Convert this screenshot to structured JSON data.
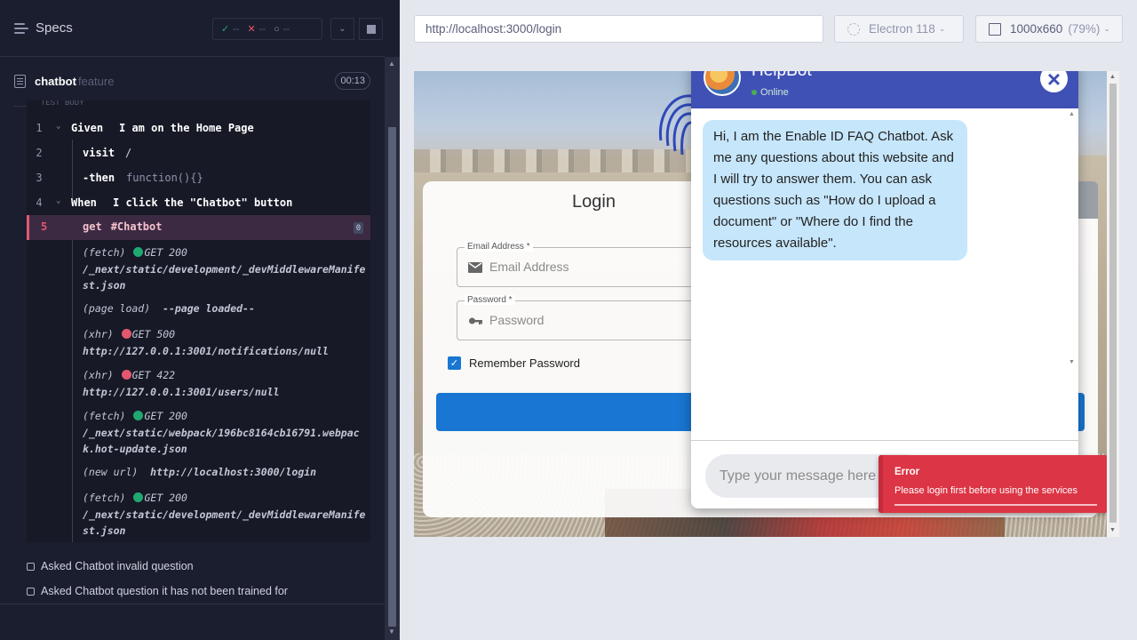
{
  "runner": {
    "header": {
      "title": "Specs"
    },
    "stats": {
      "passed": "--",
      "failed": "--",
      "pending": "--"
    },
    "spec": {
      "name": "chatbot",
      "ext": "feature",
      "duration": "00:13"
    },
    "section_cut_label": "TEST BODY",
    "lines": [
      {
        "num": "1",
        "keyword": "Given",
        "text": "I am on the Home Page"
      },
      {
        "num": "2",
        "cmd": "visit",
        "arg": "/"
      },
      {
        "num": "3",
        "cmd": "-then",
        "arg": "function(){}"
      },
      {
        "num": "4",
        "keyword": "When",
        "text": "I click the \"Chatbot\" button"
      },
      {
        "num": "5",
        "cmd": "get",
        "arg": "#Chatbot",
        "badge": "0"
      }
    ],
    "logs": [
      {
        "tag": "(fetch)",
        "status": "GET 200",
        "url": "/_next/static/development/_devMiddlewareManifest.json"
      },
      {
        "tag": "(page load)",
        "text": "--page loaded--"
      },
      {
        "tag": "(xhr)",
        "status": "GET 500",
        "url": "http://127.0.0.1:3001/notifications/null"
      },
      {
        "tag": "(xhr)",
        "status": "GET 422",
        "url": "http://127.0.0.1:3001/users/null"
      },
      {
        "tag": "(fetch)",
        "status": "GET 200",
        "url": "/_next/static/webpack/196bc8164cb16791.webpack.hot-update.json"
      },
      {
        "tag": "(new url)",
        "url": "http://localhost:3000/login"
      },
      {
        "tag": "(fetch)",
        "status": "GET 200",
        "url": "/_next/static/development/_devMiddlewareManifest.json"
      }
    ],
    "tests": [
      {
        "label": "Asked Chatbot invalid question"
      },
      {
        "label": "Asked Chatbot question it has not been trained for"
      }
    ]
  },
  "aut": {
    "url": "http://localhost:3000/login",
    "browser": "Electron 118",
    "viewport": "1000x660",
    "zoom": "(79%)"
  },
  "app": {
    "login": {
      "title": "Login",
      "email_label": "Email Address *",
      "email_placeholder": "Email Address",
      "password_label": "Password *",
      "password_placeholder": "Password",
      "remember": "Remember Password"
    },
    "chatbot": {
      "name": "HelpBot",
      "status": "Online",
      "close": "×",
      "message": "Hi, I am the Enable ID FAQ Chatbot. Ask me any questions about this website and I will try to answer them. You can ask questions such as \"How do I upload a document\" or \"Where do I find the resources available\".",
      "input_placeholder": "Type your message here"
    },
    "toast": {
      "title": "Error",
      "message": "Please login first before using the services"
    }
  },
  "colors": {
    "runner_bg": "#1b1e2e",
    "active_command": "#e45770",
    "passed": "#1fa971",
    "chat_header": "#3f51b5",
    "chat_bubble": "#c6e6fb",
    "error_toast": "#dc3545",
    "primary_button": "#1976d2"
  }
}
